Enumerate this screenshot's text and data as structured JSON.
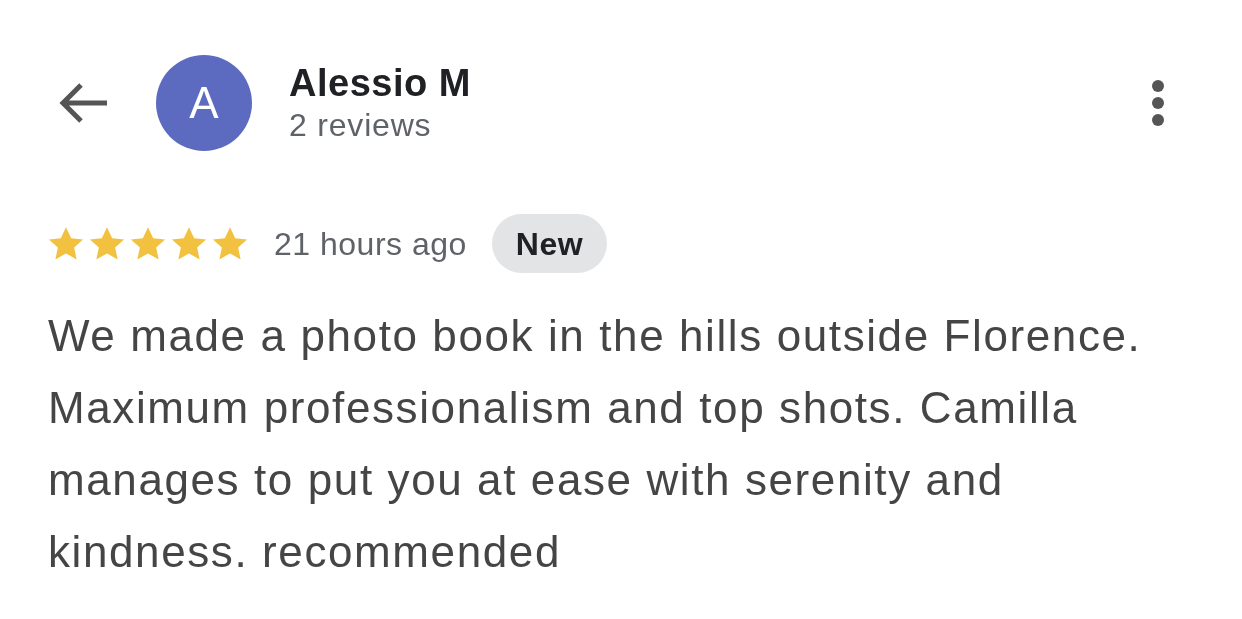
{
  "reviewer": {
    "avatar_initial": "A",
    "name": "Alessio M",
    "review_count": "2 reviews"
  },
  "review": {
    "stars": 5,
    "time": "21 hours ago",
    "badge": "New",
    "text": "We made a photo book in the hills outside Florence. Maximum professionalism and top shots. Camilla manages to put you at ease with serenity and kindness. recommended"
  }
}
